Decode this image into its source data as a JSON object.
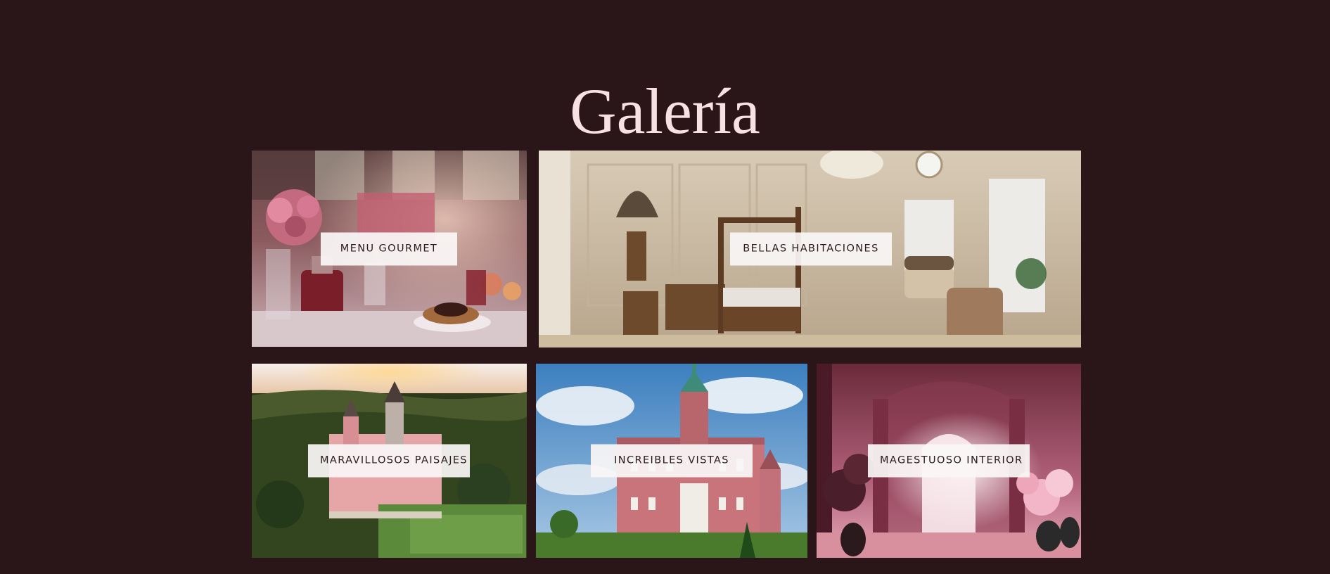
{
  "gallery": {
    "title": "Galería",
    "tiles": [
      {
        "label": "MENU GOURMET",
        "image": "gourmet-dinner-table-photo"
      },
      {
        "label": "BELLAS HABITACIONES",
        "image": "luxury-bedroom-photo"
      },
      {
        "label": "MARAVILLOSOS PAISAJES",
        "image": "castle-landscape-aerial-photo"
      },
      {
        "label": "INCREIBLES VISTAS",
        "image": "castle-facade-photo"
      },
      {
        "label": "MAGESTUOSO INTERIOR",
        "image": "pink-palace-interior-photo"
      }
    ]
  },
  "colors": {
    "background": "#2a1518",
    "title": "#f8e1e3",
    "label_background": "#faf6f6",
    "label_text": "#2a1a1c"
  }
}
